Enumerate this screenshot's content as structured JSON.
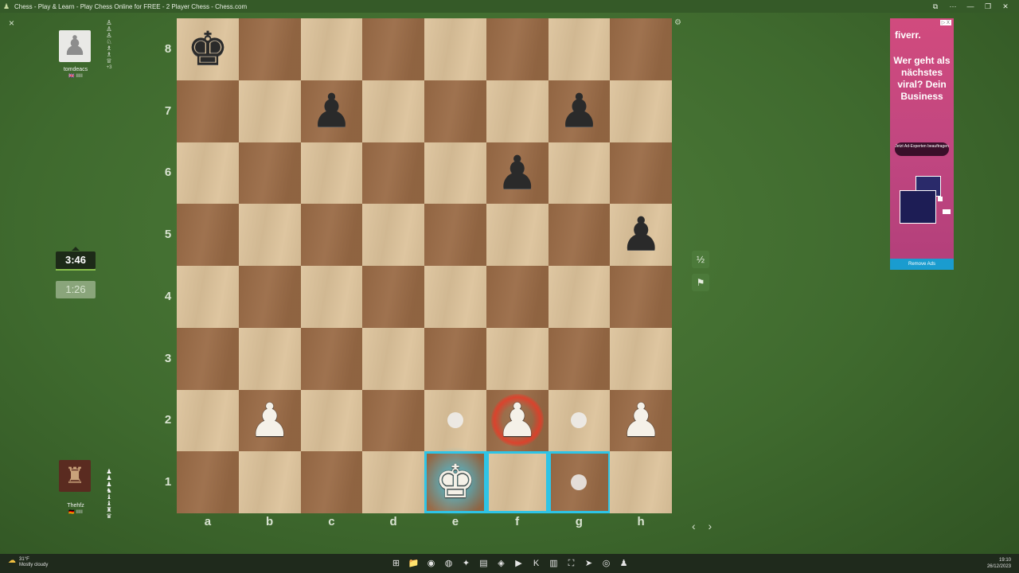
{
  "window": {
    "title": "Chess - Play & Learn - Play Chess Online for FREE - 2 Player Chess - Chess.com",
    "controls": [
      "⧉",
      "⋯",
      "—",
      "❐",
      "✕"
    ]
  },
  "close_label": "×",
  "players": {
    "top": {
      "name": "tomdeacs",
      "flag": "🇬🇧",
      "rating_marks": "IIIII",
      "avatar_glyph": "♟",
      "captured": "♙♙♙♘♗♗♕",
      "captured_extra": "+3"
    },
    "bottom": {
      "name": "Thehfz",
      "flag": "🇩🇪",
      "rating_marks": "IIIII",
      "avatar_glyph": "♜",
      "captured": "♟♟♟♞♝♝♜♛"
    }
  },
  "clocks": {
    "active": "3:46",
    "idle": "1:26"
  },
  "board": {
    "files": [
      "a",
      "b",
      "c",
      "d",
      "e",
      "f",
      "g",
      "h"
    ],
    "ranks": [
      "8",
      "7",
      "6",
      "5",
      "4",
      "3",
      "2",
      "1"
    ],
    "pieces": [
      {
        "square": "a8",
        "glyph": "♚",
        "color": "black",
        "name": "black-king"
      },
      {
        "square": "c7",
        "glyph": "♟",
        "color": "black",
        "name": "black-pawn"
      },
      {
        "square": "g7",
        "glyph": "♟",
        "color": "black",
        "name": "black-pawn"
      },
      {
        "square": "f6",
        "glyph": "♟",
        "color": "black",
        "name": "black-pawn"
      },
      {
        "square": "h5",
        "glyph": "♟",
        "color": "black",
        "name": "black-pawn"
      },
      {
        "square": "b2",
        "glyph": "♟",
        "color": "white",
        "name": "white-pawn"
      },
      {
        "square": "f2",
        "glyph": "♟",
        "color": "white",
        "name": "white-pawn"
      },
      {
        "square": "h2",
        "glyph": "♟",
        "color": "white",
        "name": "white-pawn"
      },
      {
        "square": "e1",
        "glyph": "♚",
        "color": "white",
        "name": "white-king"
      }
    ],
    "highlighted": [
      "e1",
      "f1",
      "g1"
    ],
    "move_hints": [
      "e2",
      "g2",
      "g1"
    ],
    "check_square": "f2",
    "selected_square": "e1"
  },
  "side_buttons": {
    "draw": "½",
    "resign": "⚑",
    "settings": "⚙",
    "nav": "‹ ›"
  },
  "ad": {
    "brand": "fiverr.",
    "ad_choice": "▷ X",
    "headline": "Wer geht als nächstes viral? Dein Business",
    "cta": "Jetzt Ad-Experten beauftragen",
    "remove": "Remove Ads"
  },
  "taskbar": {
    "weather_temp": "31°F",
    "weather_desc": "Mostly cloudy",
    "time": "19:10",
    "date": "26/12/2023",
    "icons": [
      "⊞",
      "📁",
      "◉",
      "◍",
      "✦",
      "▤",
      "◈",
      "▶",
      "K",
      "▥",
      "⛶",
      "➤",
      "◎",
      "♟"
    ]
  }
}
